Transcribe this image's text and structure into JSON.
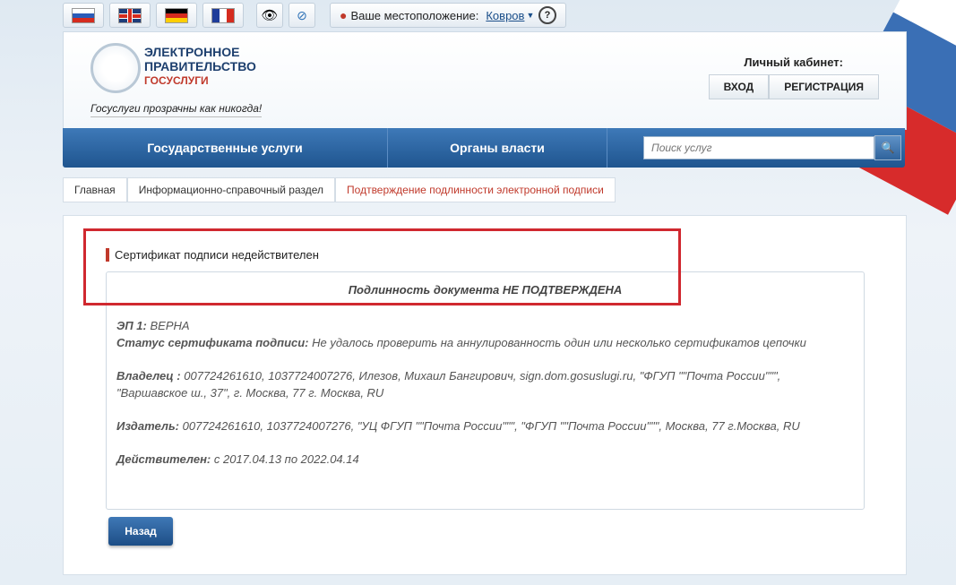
{
  "location": {
    "label": "Ваше местоположение:",
    "city": "Ковров"
  },
  "header": {
    "logo_line1": "ЭЛЕКТРОННОЕ",
    "logo_line2": "ПРАВИТЕЛЬСТВО",
    "logo_line3": "ГОСУСЛУГИ",
    "slogan": "Госуслуги прозрачны как никогда!",
    "cabinet_label": "Личный кабинет:",
    "login_button": "ВХОД",
    "register_button": "РЕГИСТРАЦИЯ"
  },
  "nav": {
    "item1": "Государственные услуги",
    "item2": "Органы власти",
    "search_placeholder": "Поиск услуг"
  },
  "breadcrumbs": [
    "Главная",
    "Информационно-справочный раздел",
    "Подтверждение подлинности электронной подписи"
  ],
  "content": {
    "title": "Сертификат подписи недействителен",
    "status": "Подлинность документа НЕ ПОДТВЕРЖДЕНА",
    "ep_label": "ЭП 1:",
    "ep_value": "ВЕРНА",
    "cert_status_label": "Статус сертификата подписи:",
    "cert_status_value": "Не удалось проверить на аннулированность один или несколько сертификатов цепочки",
    "owner_label": "Владелец :",
    "owner_value": "007724261610, 1037724007276, Илезов, Михаил Бангирович, sign.dom.gosuslugi.ru, \"ФГУП \"\"Почта России\"\"\", \"Варшавское ш., 37\", г. Москва, 77 г. Москва, RU",
    "issuer_label": "Издатель:",
    "issuer_value": "007724261610, 1037724007276, \"УЦ ФГУП \"\"Почта России\"\"\", \"ФГУП \"\"Почта России\"\"\", Москва, 77 г.Москва, RU",
    "valid_label": "Действителен:",
    "valid_value": "с 2017.04.13 по 2022.04.14",
    "back_button": "Назад"
  },
  "colors": {
    "accent": "#1f558f",
    "alert": "#d0282f"
  }
}
